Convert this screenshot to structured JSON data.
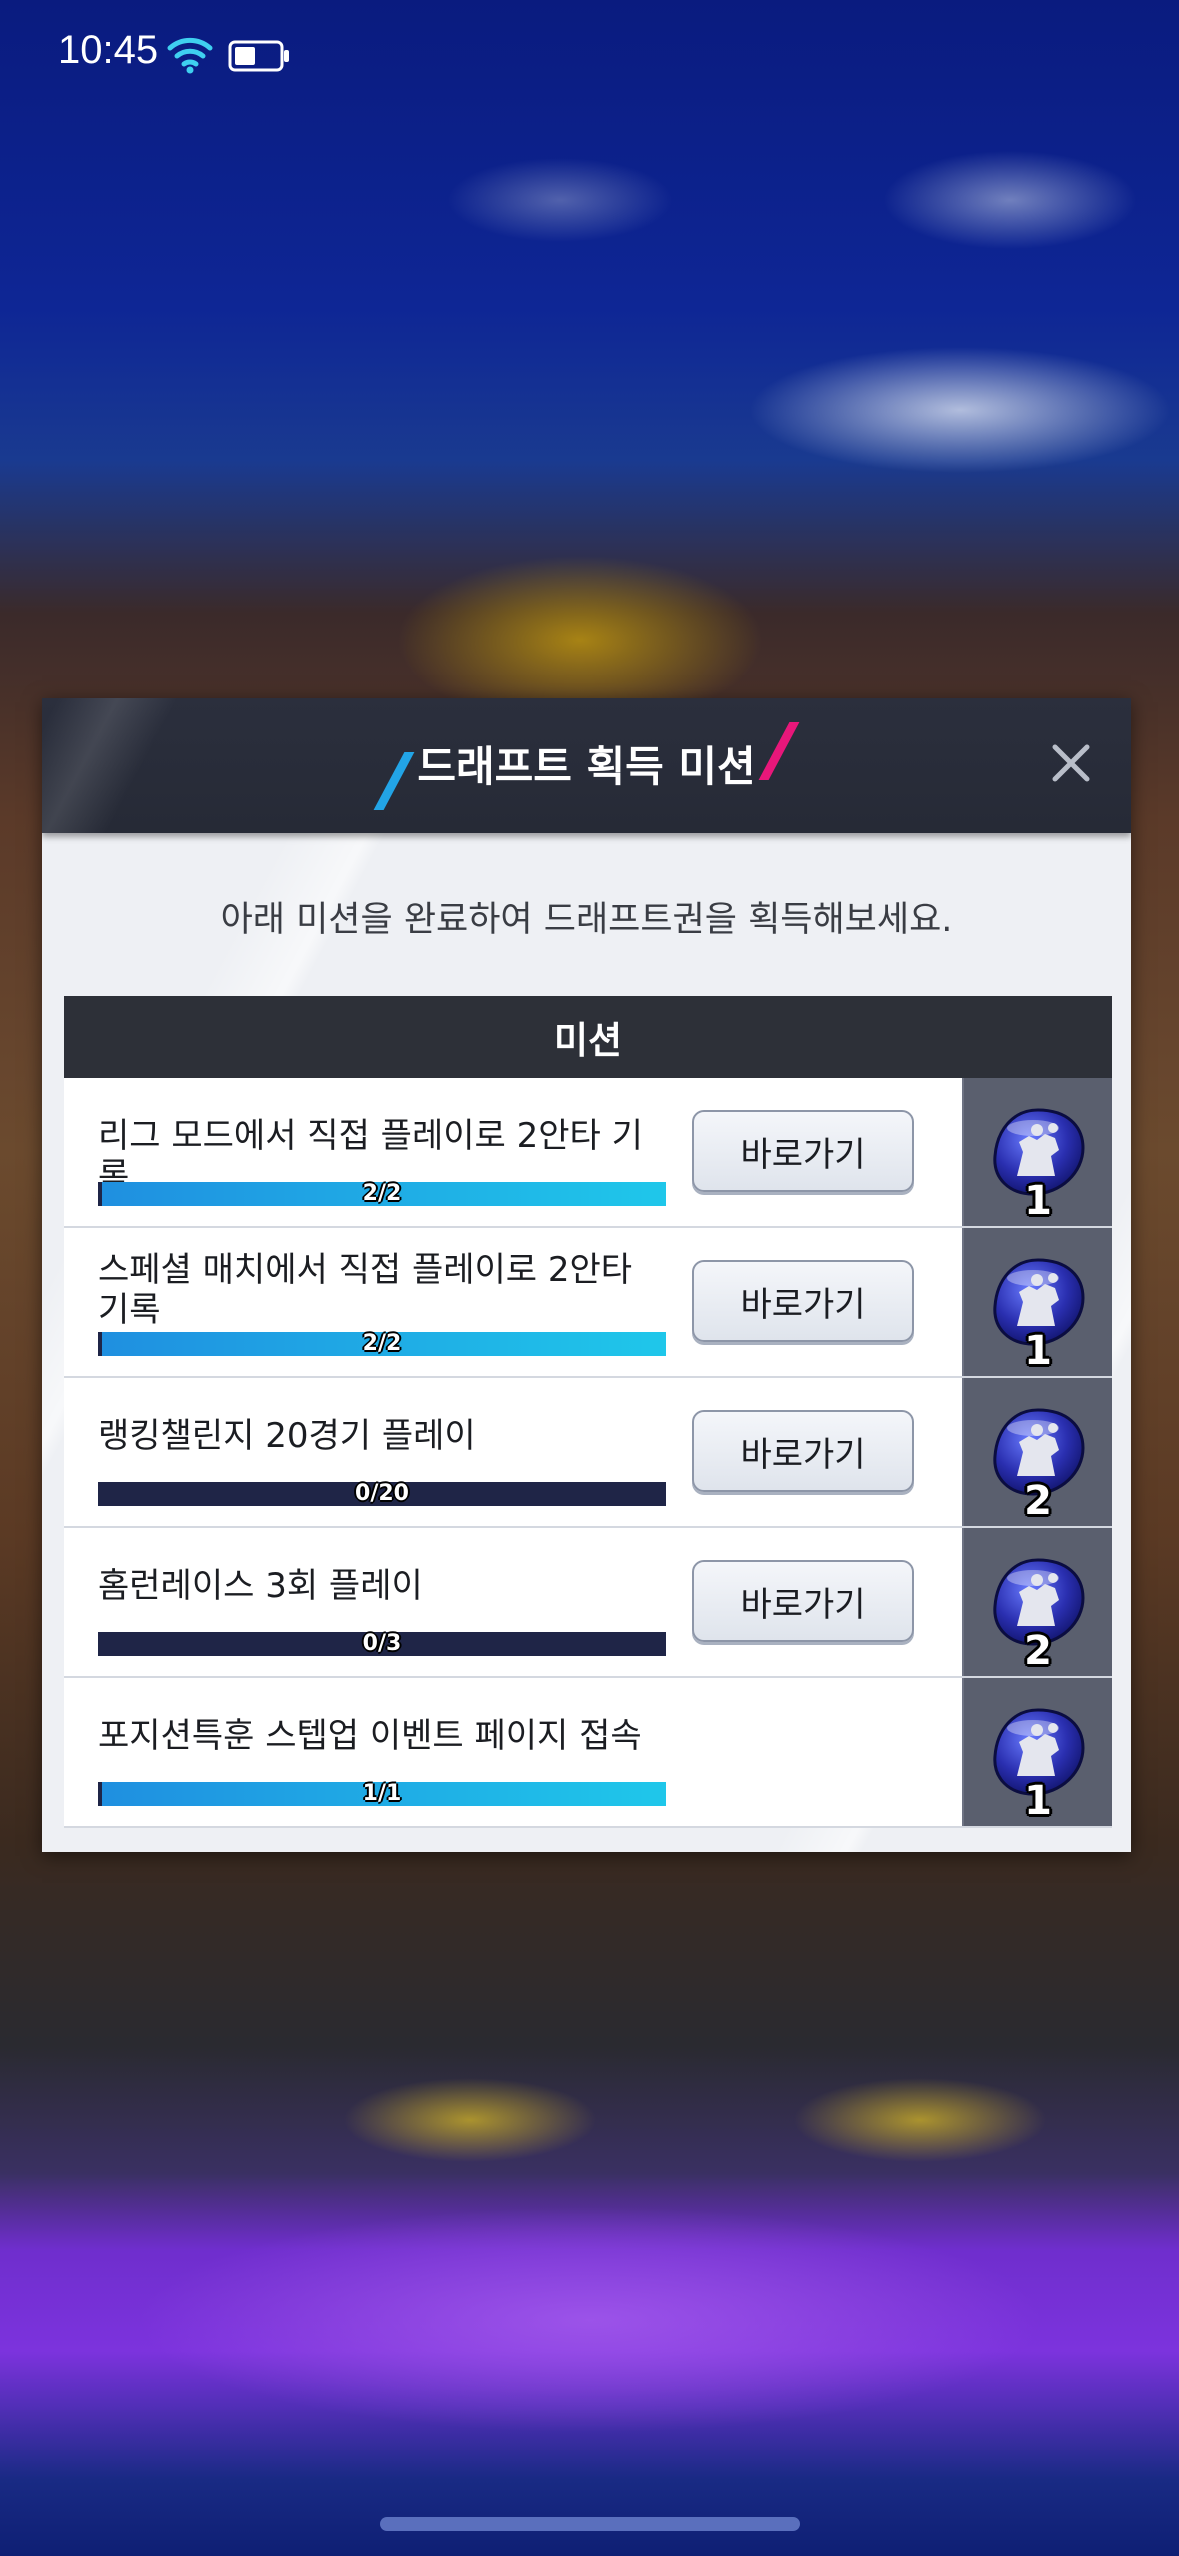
{
  "status_bar": {
    "time": "10:45",
    "wifi_icon": "wifi-icon",
    "battery_icon": "battery-icon"
  },
  "dialog": {
    "title": "드래프트 획득 미션",
    "subtitle": "아래 미션을 완료하여 드래프트권을 획득해보세요.",
    "close_icon": "close-icon",
    "table_header": "미션",
    "go_button_label": "바로가기",
    "missions": [
      {
        "label": "리그 모드에서 직접 플레이로 2안타 기록",
        "progress_text": "2/2",
        "progress": 1.0,
        "has_button": true,
        "reward_count": "1"
      },
      {
        "label": "스페셜 매치에서 직접 플레이로 2안타 기록",
        "progress_text": "2/2",
        "progress": 1.0,
        "has_button": true,
        "reward_count": "1"
      },
      {
        "label": "랭킹챌린지 20경기 플레이",
        "progress_text": "0/20",
        "progress": 0.0,
        "has_button": true,
        "reward_count": "2"
      },
      {
        "label": "홈런레이스 3회 플레이",
        "progress_text": "0/3",
        "progress": 0.0,
        "has_button": true,
        "reward_count": "2"
      },
      {
        "label": "포지션특훈 스텝업 이벤트 페이지 접속",
        "progress_text": "1/1",
        "progress": 1.0,
        "has_button": false,
        "reward_count": "1"
      }
    ],
    "reward_icon": "draft-ticket-icon"
  },
  "colors": {
    "accent_blue": "#22a4e6",
    "accent_pink": "#e8177a",
    "progress_fill": "#1fc7ea",
    "progress_track": "#1f2547"
  }
}
